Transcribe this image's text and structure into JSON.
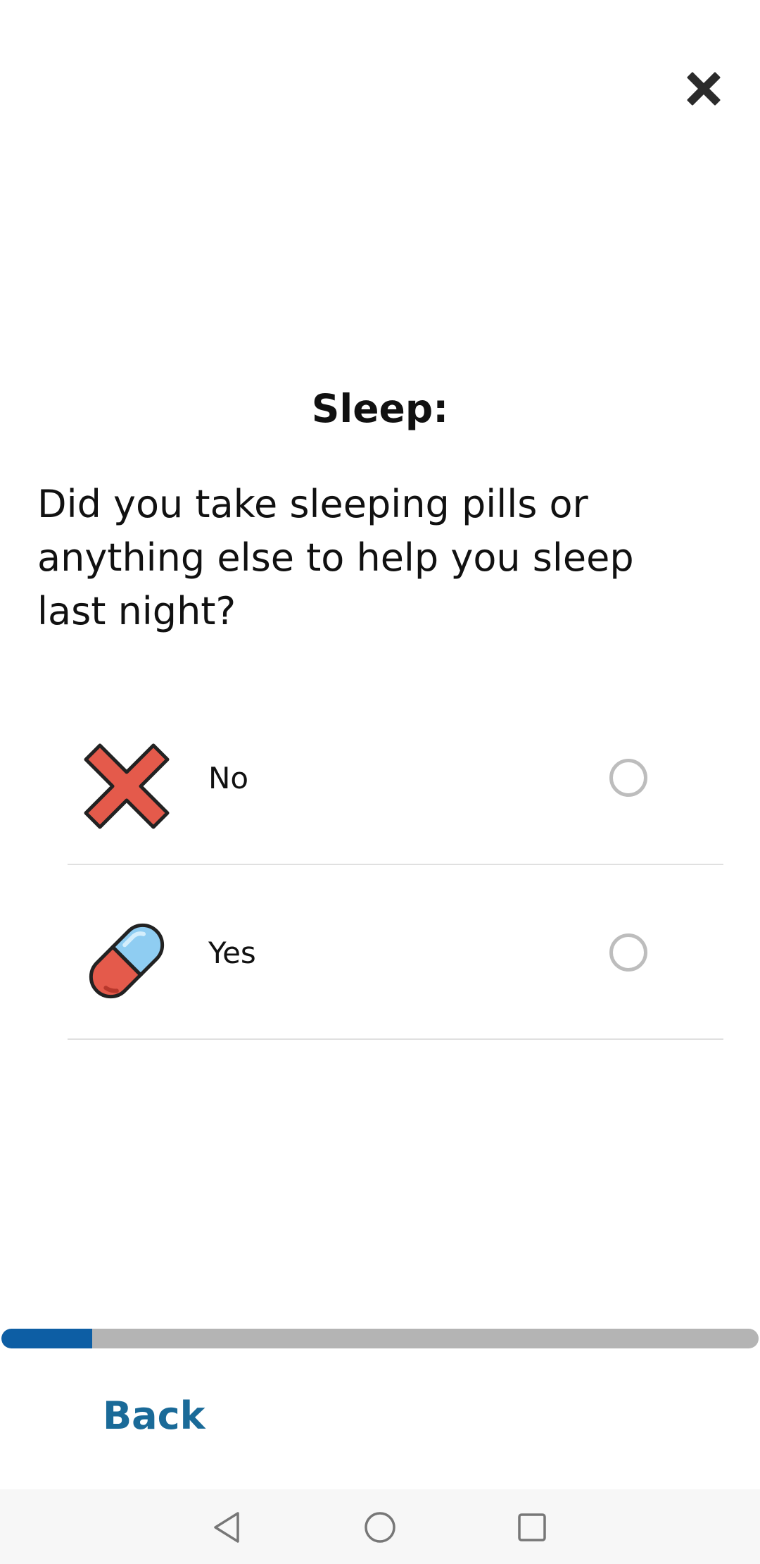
{
  "header": {
    "close_icon": "close-icon"
  },
  "survey": {
    "title": "Sleep:",
    "question": "Did you take sleeping pills or anything else to help you sleep last night?",
    "options": [
      {
        "label": "No",
        "icon": "red-x-icon",
        "selected": false
      },
      {
        "label": "Yes",
        "icon": "pill-icon",
        "selected": false
      }
    ]
  },
  "progress": {
    "value_percent": 12,
    "fill_color": "#0d5ea4",
    "track_color": "#b4b4b4"
  },
  "footer": {
    "back_label": "Back",
    "back_color": "#1a6a98"
  },
  "system_nav": {
    "icons": [
      "nav-back-icon",
      "nav-home-icon",
      "nav-recents-icon"
    ]
  }
}
